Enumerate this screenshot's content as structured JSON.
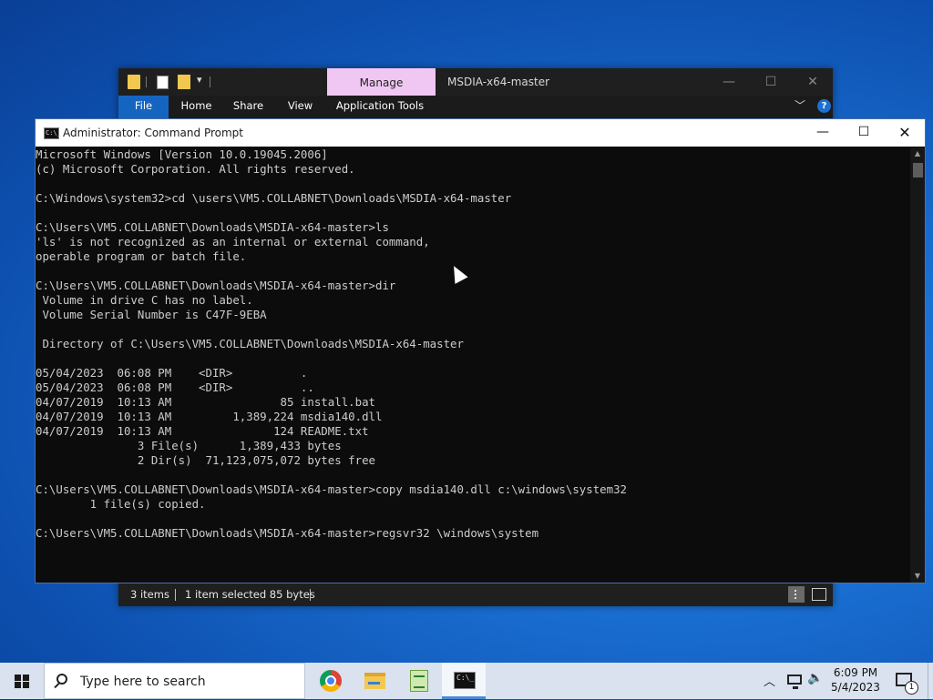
{
  "explorer": {
    "title": "MSDIA-x64-master",
    "context_tab": "Manage",
    "quick_access_drop": "▾",
    "ribbon_tabs": [
      "File",
      "Home",
      "Share",
      "View",
      "Application Tools"
    ],
    "status": {
      "items": "3 items",
      "selected": "1 item selected  85 bytes"
    },
    "accent_color": "#1565c0",
    "context_tab_color": "#f0c7f3"
  },
  "cmd": {
    "title": "Administrator: Command Prompt",
    "icon_text": "C:\\_",
    "lines": [
      "Microsoft Windows [Version 10.0.19045.2006]",
      "(c) Microsoft Corporation. All rights reserved.",
      "",
      "C:\\Windows\\system32>cd \\users\\VM5.COLLABNET\\Downloads\\MSDIA-x64-master",
      "",
      "C:\\Users\\VM5.COLLABNET\\Downloads\\MSDIA-x64-master>ls",
      "'ls' is not recognized as an internal or external command,",
      "operable program or batch file.",
      "",
      "C:\\Users\\VM5.COLLABNET\\Downloads\\MSDIA-x64-master>dir",
      " Volume in drive C has no label.",
      " Volume Serial Number is C47F-9EBA",
      "",
      " Directory of C:\\Users\\VM5.COLLABNET\\Downloads\\MSDIA-x64-master",
      "",
      "05/04/2023  06:08 PM    <DIR>          .",
      "05/04/2023  06:08 PM    <DIR>          ..",
      "04/07/2019  10:13 AM                85 install.bat",
      "04/07/2019  10:13 AM         1,389,224 msdia140.dll",
      "04/07/2019  10:13 AM               124 README.txt",
      "               3 File(s)      1,389,433 bytes",
      "               2 Dir(s)  71,123,075,072 bytes free",
      "",
      "C:\\Users\\VM5.COLLABNET\\Downloads\\MSDIA-x64-master>copy msdia140.dll c:\\windows\\system32",
      "        1 file(s) copied.",
      "",
      "C:\\Users\\VM5.COLLABNET\\Downloads\\MSDIA-x64-master>regsvr32 \\windows\\system"
    ]
  },
  "window_controls": {
    "minimize": "—",
    "maximize": "☐",
    "close": "✕"
  },
  "taskbar": {
    "search_placeholder": "Type here to search",
    "pinned_apps": [
      "chrome-icon",
      "file-explorer-icon",
      "notepad-icon",
      "command-prompt-icon"
    ],
    "tray": {
      "chevron": "︿",
      "volume": "🔈",
      "time": "6:09 PM",
      "date": "5/4/2023",
      "notification_count": "1"
    }
  }
}
